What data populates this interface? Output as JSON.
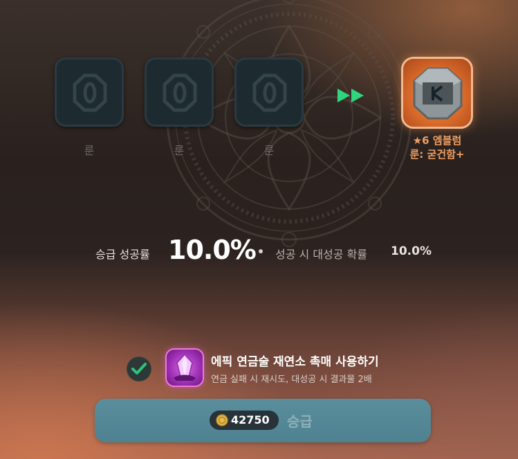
{
  "rune_slots": [
    {
      "label": "룬"
    },
    {
      "label": "룬"
    },
    {
      "label": "룬"
    }
  ],
  "result": {
    "name": "★6 엠블럼",
    "subname": "룬: 굳건함+",
    "frame_color": "#f4b98e",
    "text_color": "#f2a063"
  },
  "rates": {
    "success_label": "승급 성공률",
    "success_value": "10.0%",
    "crit_label": "성공 시 대성공 확률",
    "crit_value": "10.0%"
  },
  "catalyst": {
    "checked": true,
    "title": "에픽 연금술 재연소 촉매 사용하기",
    "description": "연금 실패 시 재시도, 대성공 시 결과물 2배",
    "accent": "#2ec27e"
  },
  "upgrade": {
    "cost": "42750",
    "label": "승급",
    "button_color": "#5a8e9c"
  }
}
